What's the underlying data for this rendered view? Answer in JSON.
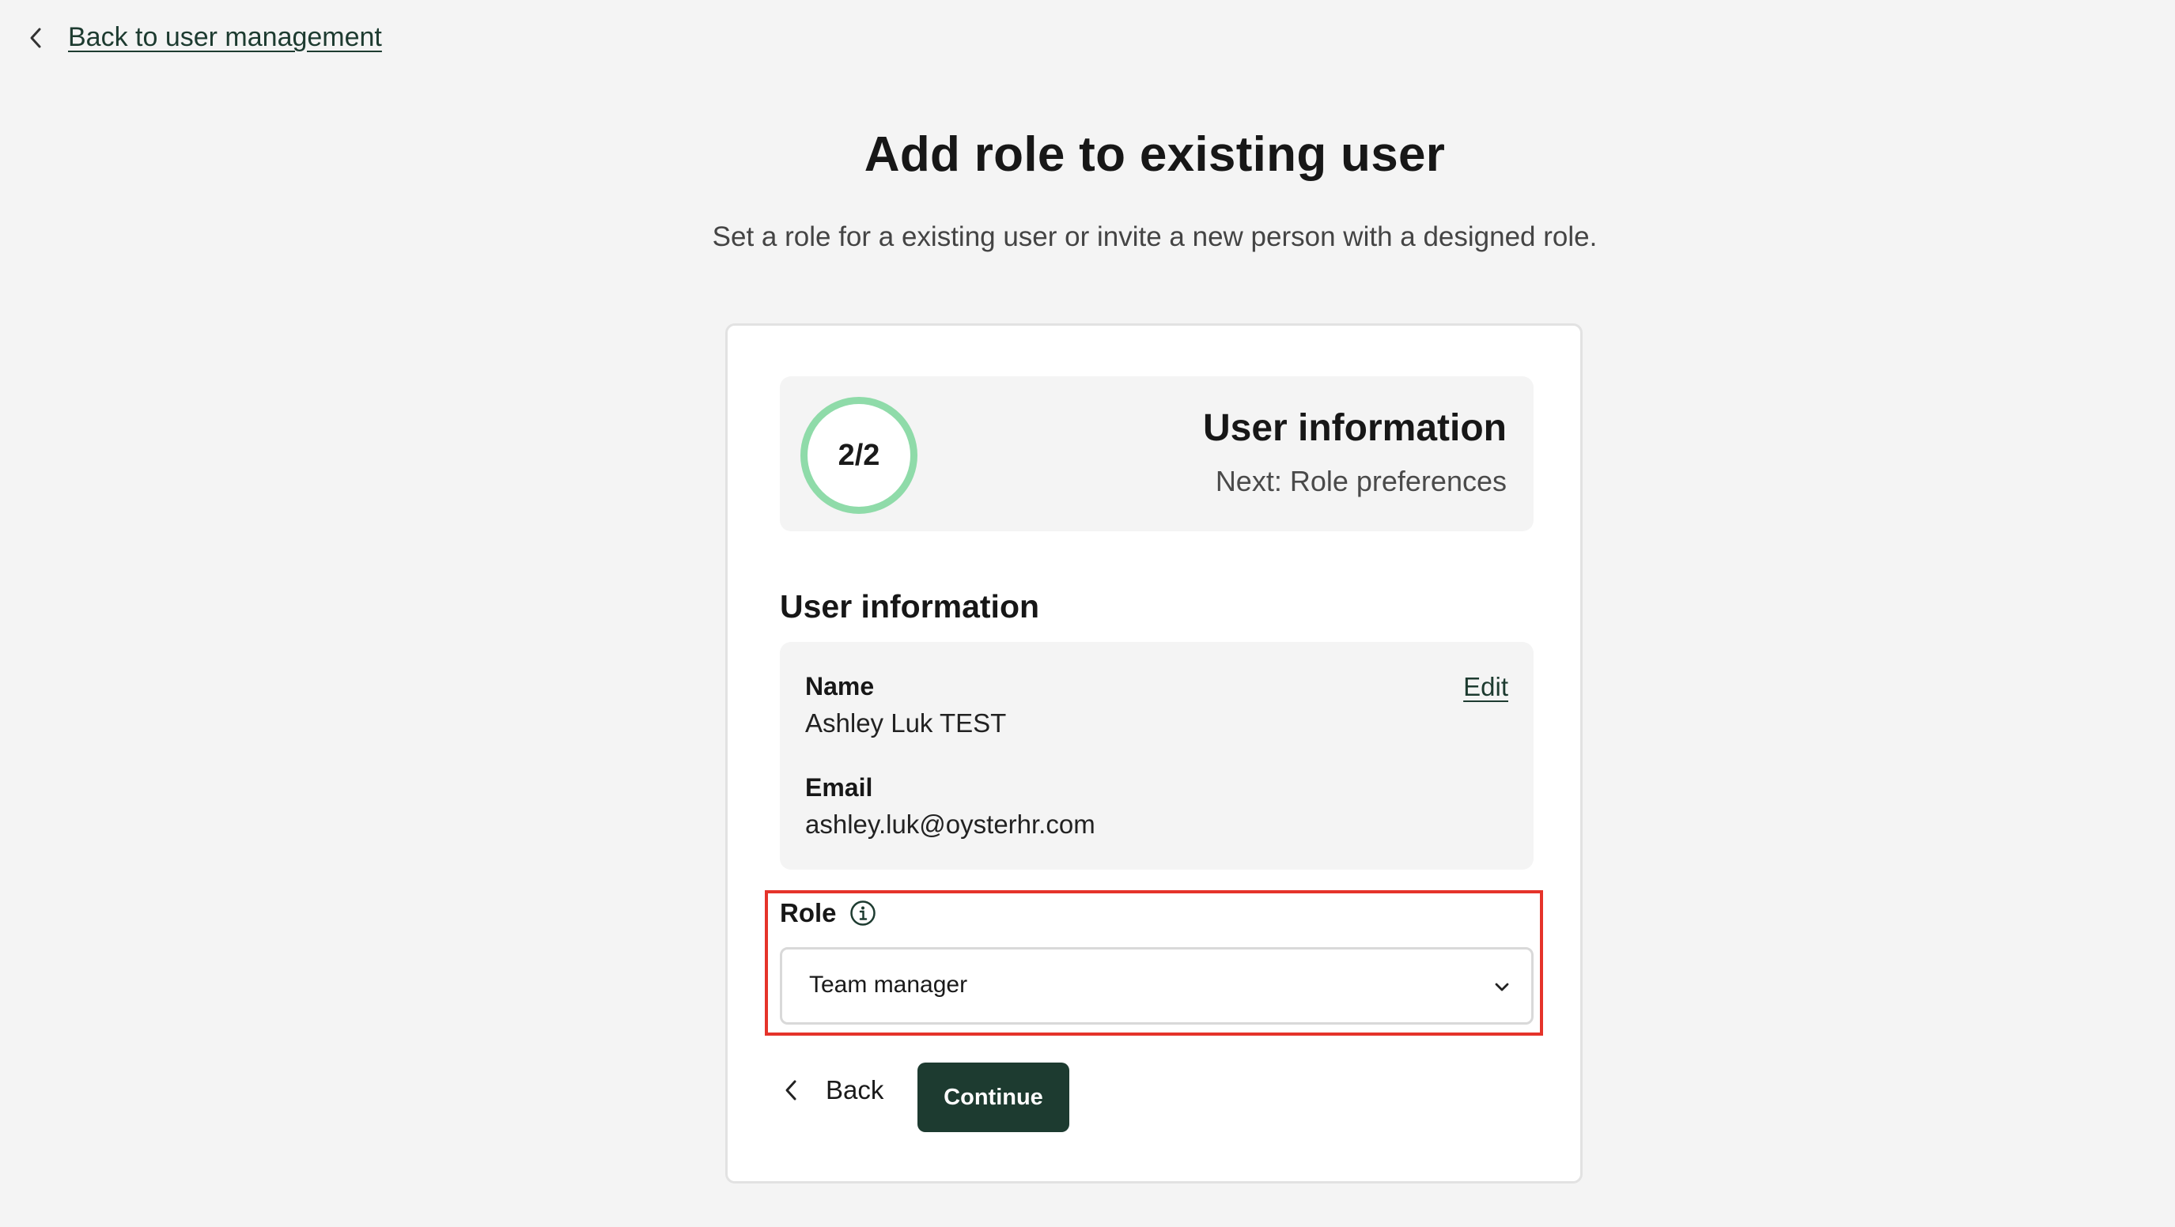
{
  "nav": {
    "back_link_label": "Back to user management"
  },
  "header": {
    "title": "Add role to existing user",
    "subtitle": "Set a role for a existing user or invite a new person with a designed role."
  },
  "stepper": {
    "progress": "2/2",
    "title": "User information",
    "next": "Next: Role preferences"
  },
  "user_info": {
    "section_title": "User information",
    "edit_label": "Edit",
    "name_label": "Name",
    "name_value": "Ashley Luk TEST",
    "email_label": "Email",
    "email_value": "ashley.luk@oysterhr.com"
  },
  "role": {
    "label": "Role",
    "selected": "Team manager"
  },
  "actions": {
    "back_label": "Back",
    "continue_label": "Continue"
  },
  "colors": {
    "primary": "#1d3b30",
    "progress_ring": "#8fdba9",
    "highlight": "#e5332a",
    "background": "#f4f4f4"
  },
  "icons": {
    "back_link": "chevron-left-icon",
    "role_info": "info-icon",
    "select_caret": "chevron-down-icon",
    "back_button": "chevron-left-icon"
  }
}
